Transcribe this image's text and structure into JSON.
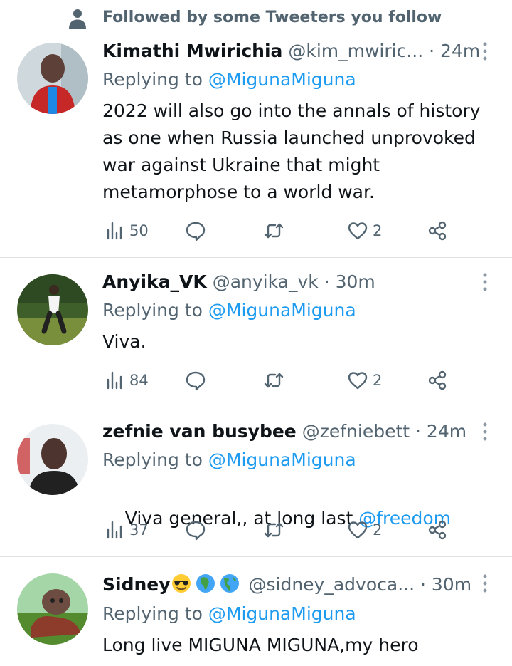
{
  "context": {
    "followed_text": "Followed by some Tweeters you follow",
    "icon": "person-icon"
  },
  "tweets": [
    {
      "name": "Kimathi Mwirichia",
      "handle": "@kim_mwiric...",
      "dot": "·",
      "time": "24m",
      "replying_prefix": "Replying to ",
      "replying_to": "@MigunaMiguna",
      "text_lines": [
        "2022 will also go into the annals of history",
        "as one when Russia launched unprovoked",
        "war against Ukraine that might",
        "metamorphose to a world war."
      ],
      "views": "50",
      "likes": "2"
    },
    {
      "name": "Anyika_VK",
      "handle": "@anyika_vk",
      "dot": "·",
      "time": "30m",
      "replying_prefix": "Replying to ",
      "replying_to": "@MigunaMiguna",
      "text": "Viva.",
      "views": "84",
      "likes": "2"
    },
    {
      "name": "zefnie van busybee",
      "handle": "@zefniebett",
      "dot": "·",
      "time": "24m",
      "replying_prefix": "Replying to ",
      "replying_to": "@MigunaMiguna",
      "text": "Viva general,, at long last ",
      "text_mention": "@freedom",
      "views": "37",
      "likes": "2"
    },
    {
      "name": "Sidney",
      "name_emojis": [
        "smiling-face-with-sunglasses-emoji",
        "globe-africa-emoji",
        "globe-americas-emoji"
      ],
      "handle": "@sidney_advoca...",
      "dot": "·",
      "time": "30m",
      "replying_prefix": "Replying to ",
      "replying_to": "@MigunaMiguna",
      "text": "Long live MIGUNA MIGUNA,my hero"
    }
  ],
  "colors": {
    "text_primary": "#0f1419",
    "text_secondary": "#536471",
    "link": "#1d9bf0",
    "divider": "#dfe3e6"
  }
}
